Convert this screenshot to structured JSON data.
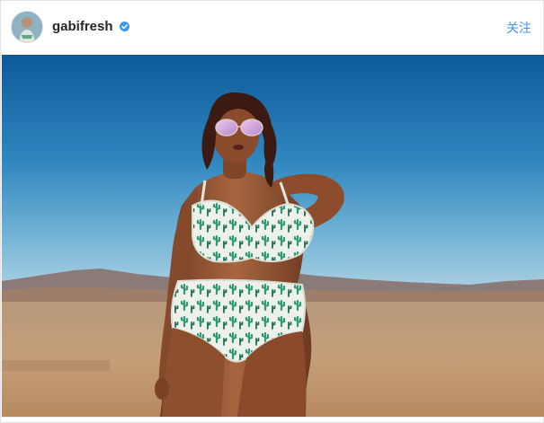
{
  "post": {
    "username": "gabifresh",
    "follow_label": "关注",
    "verified": true,
    "avatar_icon": "profile-avatar",
    "photo_icon": "beach-photo"
  },
  "colors": {
    "follow_blue": "#3897f0",
    "verified_blue": "#3897f0",
    "username_text": "#262626"
  }
}
